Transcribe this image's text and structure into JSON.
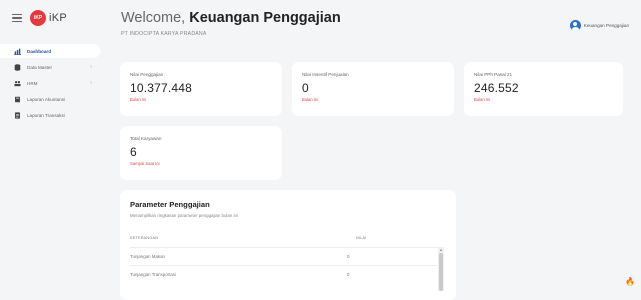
{
  "app": {
    "logo_text": "iKP",
    "logo_badge": "iKP"
  },
  "sidebar": {
    "items": [
      {
        "label": "Dashboard",
        "icon": "chart-bar-icon",
        "active": true
      },
      {
        "label": "Data Master",
        "icon": "database-icon",
        "chevron": "›"
      },
      {
        "label": "HRM",
        "icon": "people-icon",
        "chevron": "›"
      },
      {
        "label": "Laporan Akuntansi",
        "icon": "book-icon"
      },
      {
        "label": "Laporan Transaksi",
        "icon": "document-icon"
      }
    ]
  },
  "header": {
    "welcome_prefix": "Welcome,",
    "welcome_name": "Keuangan Penggajian",
    "company": "PT INDOCIPTA KARYA PRADANA",
    "user_name": "Keuangan Penggajian"
  },
  "cards": [
    {
      "label": "Nilai Penggajian",
      "value": "10.377.448",
      "sub": "Bulan Ini"
    },
    {
      "label": "Nilai Insentif Penjualan",
      "value": "0",
      "sub": "Bulan Ini"
    },
    {
      "label": "Nilai PPh Pasal 21",
      "value": "246.552",
      "sub": "Bulan Ini"
    },
    {
      "label": "Total Karyawan",
      "value": "6",
      "sub": "Sampai Saat Ini"
    }
  ],
  "parameter": {
    "title": "Parameter Penggajian",
    "description": "Menampilkan ringkasan parameter penggajian bulan ini",
    "columns": {
      "keterangan": "KETERANGAN",
      "nilai": "NILAI"
    },
    "rows": [
      {
        "keterangan": "Tunjangan Makan",
        "nilai": "0"
      },
      {
        "keterangan": "Tunjangan Transportasi",
        "nilai": "0"
      }
    ]
  },
  "colors": {
    "accent": "#1f4fa3",
    "brand": "#e5393d",
    "sub_text": "#d94b4b"
  }
}
